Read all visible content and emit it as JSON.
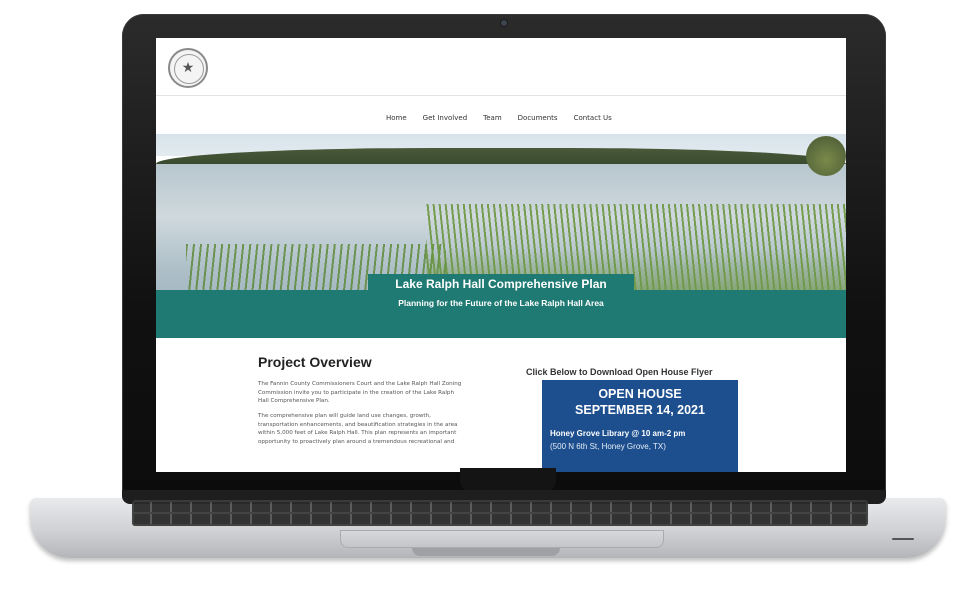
{
  "site": {
    "nav": [
      "Home",
      "Get Involved",
      "Team",
      "Documents",
      "Contact Us"
    ],
    "hero": {
      "title": "Lake Ralph Hall Comprehensive Plan",
      "subtitle": "Planning for the Future of the Lake Ralph Hall Area"
    },
    "overview": {
      "title": "Project Overview",
      "paragraph1": "The Fannin County Commissioners Court and the Lake Ralph Hall Zoning Commission invite you to participate in the creation of the Lake Ralph Hall Comprehensive Plan.",
      "paragraph2": "The comprehensive plan will guide land use changes, growth, transportation enhancements, and beautification strategies in the area within 5,000 feet of Lake Ralph Hall. This plan represents an important opportunity to proactively plan around a tremendous recreational and"
    },
    "flyer": {
      "heading": "Click Below to Download Open House Flyer",
      "line1": "OPEN HOUSE",
      "line2": "SEPTEMBER 14, 2021",
      "location": "Honey Grove Library @ 10 am-2 pm",
      "address": "(500 N 6th St, Honey Grove, TX)"
    }
  },
  "colors": {
    "hero_band": "#1f7a73",
    "flyer_bg": "#1d4f8f",
    "laptop_bezel": "#111111",
    "laptop_body": "#cfd1d4"
  },
  "icons": {
    "seal": "county-seal-icon"
  }
}
